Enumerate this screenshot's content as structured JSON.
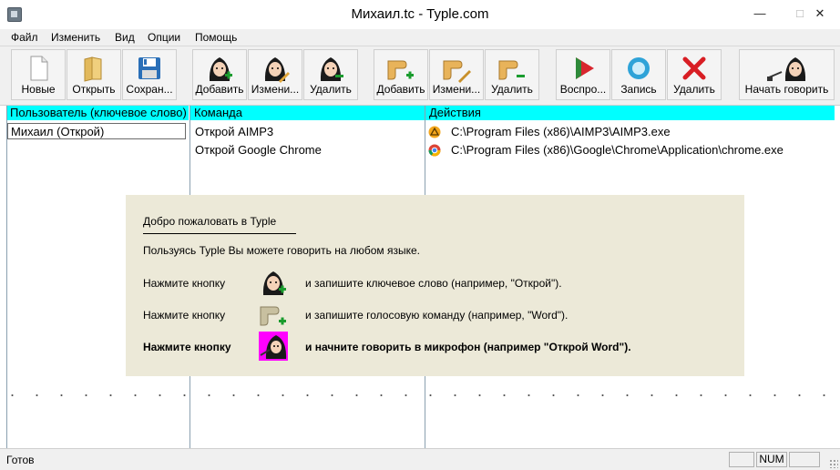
{
  "window": {
    "title": "Михаил.tc - Typle.com",
    "controls": {
      "minimize": "—",
      "maximize": "□",
      "close": "✕"
    }
  },
  "menu": [
    "Файл",
    "Изменить",
    "Вид",
    "Опции",
    "Помощь"
  ],
  "toolbar": {
    "buttons": [
      {
        "label": "Новые",
        "icon": "new-file-icon"
      },
      {
        "label": "Открыть",
        "icon": "open-folder-icon"
      },
      {
        "label": "Сохран...",
        "icon": "save-disk-icon"
      },
      {
        "label": "Добавить",
        "icon": "add-user-icon"
      },
      {
        "label": "Измени...",
        "icon": "edit-user-icon"
      },
      {
        "label": "Удалить",
        "icon": "delete-user-icon"
      },
      {
        "label": "Добавить",
        "icon": "add-command-icon"
      },
      {
        "label": "Измени...",
        "icon": "edit-command-icon"
      },
      {
        "label": "Удалить",
        "icon": "delete-command-icon"
      },
      {
        "label": "Воспро...",
        "icon": "play-icon"
      },
      {
        "label": "Запись",
        "icon": "record-icon"
      },
      {
        "label": "Удалить",
        "icon": "delete-x-icon"
      },
      {
        "label": "Начать говорить",
        "icon": "start-talking-icon"
      }
    ]
  },
  "columns": {
    "headers": [
      "Пользователь (ключевое слово)",
      "Команда",
      "Действия"
    ],
    "users": [
      "Михаил (Открой)"
    ],
    "commands": [
      "Открой AIMP3",
      "Открой Google Chrome"
    ],
    "actions": [
      {
        "icon": "aimp-icon",
        "text": "C:\\Program Files (x86)\\AIMP3\\AIMP3.exe"
      },
      {
        "icon": "chrome-icon",
        "text": "C:\\Program Files (x86)\\Google\\Chrome\\Application\\chrome.exe"
      }
    ]
  },
  "welcome": {
    "title": "Добро пожаловать в Typle",
    "line1": "Пользуясь Typle Вы можете говорить на любом языке.",
    "step1_prefix": "Нажмите кнопку",
    "step1_text": "и запишите ключевое слово (например, \"Открой\").",
    "step2_prefix": "Нажмите кнопку",
    "step2_text": "и запишите голосовую команду (например, \"Word\").",
    "step3_prefix": "Нажмите кнопку",
    "step3_text": "и начните говорить в микрофон (например \"Открой Word\")."
  },
  "status": {
    "text": "Готов",
    "num": "NUM"
  },
  "colors": {
    "header_bg": "#00ffff",
    "welcome_bg": "#ece9d8",
    "toolbar_bg": "#f0f0f0"
  }
}
